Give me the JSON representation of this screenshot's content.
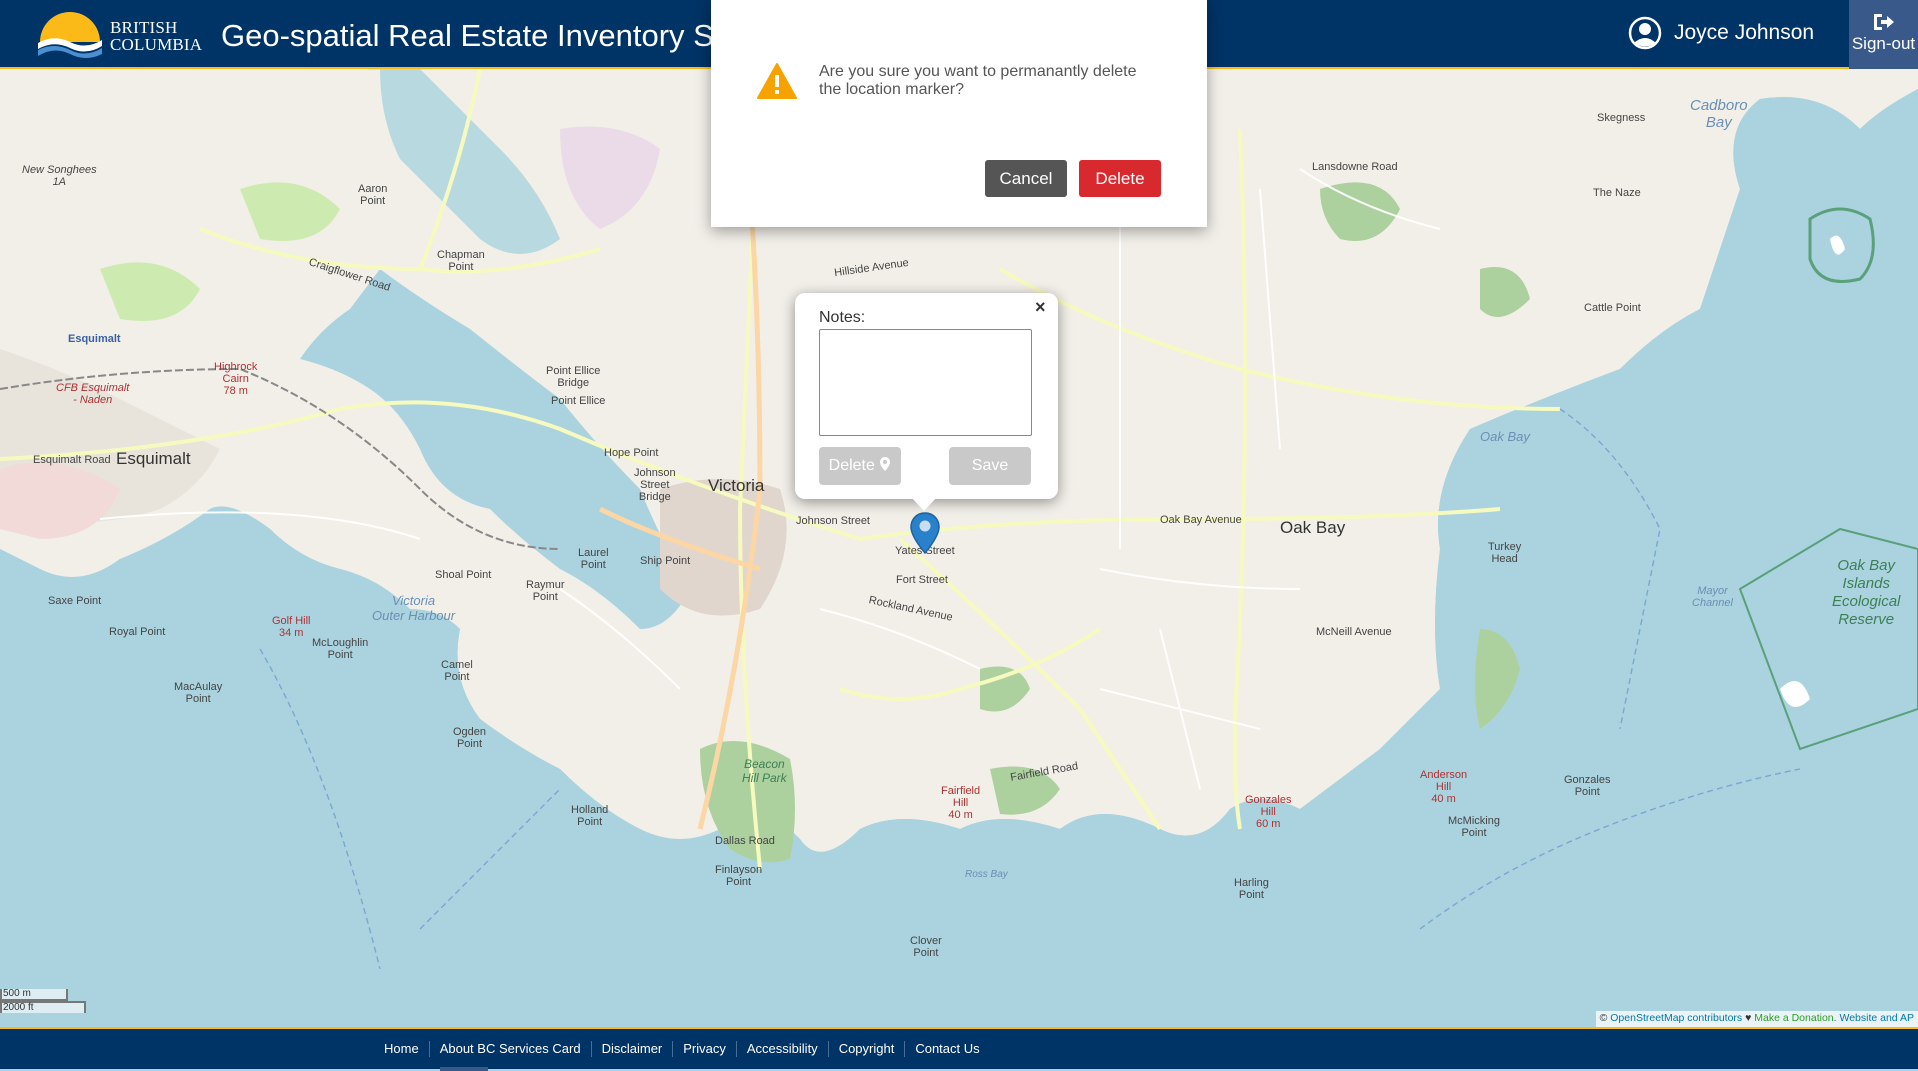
{
  "header": {
    "logo_line1": "British",
    "logo_line2": "Columbia",
    "title": "Geo-spatial Real Estate Inventory Sy",
    "user_name": "Joyce Johnson",
    "signout_label": "Sign-out"
  },
  "dialog": {
    "message": "Are you sure you want to permanantly delete the location marker?",
    "cancel_label": "Cancel",
    "delete_label": "Delete"
  },
  "popup": {
    "close_glyph": "×",
    "notes_label": "Notes:",
    "notes_value": "",
    "delete_label": "Delete",
    "save_label": "Save"
  },
  "map": {
    "labels": {
      "victoria": "Victoria",
      "esquimalt": "Esquimalt",
      "oak_bay": "Oak Bay",
      "esquimalt_small": "Esquimalt",
      "new_songhees": "New Songhees\n1A",
      "cfb": "CFB Esquimalt\n- Naden",
      "highrock": "Highrock\nCairn\n78 m",
      "golf_hill": "Golf Hill\n34 m",
      "beacon_hill": "Beacon\nHill Park",
      "fairfield_hill": "Fairfield\nHill\n40 m",
      "gonzales_hill": "Gonzales\nHill\n60 m",
      "anderson_hill": "Anderson\nHill\n40 m",
      "oak_bay_islands": "Oak Bay\nIslands\nEcological\nReserve",
      "cadboro_bay": "Cadboro\nBay",
      "oak_bay_water": "Oak Bay",
      "victoria_harbour": "Victoria\nOuter Harbour",
      "ross_bay": "Ross Bay",
      "mayor_channel": "Mayor\nChannel",
      "saxe_point": "Saxe Point",
      "royal_point": "Royal Point",
      "macaulay_point": "MacAulay\nPoint",
      "mcloughlin_point": "McLoughlin\nPoint",
      "shoal_point": "Shoal Point",
      "camel_point": "Camel\nPoint",
      "ogden_point": "Ogden\nPoint",
      "holland_point": "Holland\nPoint",
      "finlayson_point": "Finlayson\nPoint",
      "clover_point": "Clover\nPoint",
      "harling_point": "Harling\nPoint",
      "gonzales_point": "Gonzales\nPoint",
      "mcmicking_point": "McMicking\nPoint",
      "turkey_head": "Turkey\nHead",
      "cattle_point": "Cattle Point",
      "the_naze": "The Naze",
      "skegness": "Skegness",
      "point_ellice": "Point Ellice",
      "hope_point": "Hope Point",
      "johnson_bridge": "Johnson\nStreet\nBridge",
      "laurel_point": "Laurel\nPoint",
      "ship_point": "Ship Point",
      "raymur_point": "Raymur\nPoint",
      "chapman_point": "Chapman\nPoint",
      "aaron_point": "Aaron\nPoint",
      "point_ellice_bridge": "Point Ellice\nBridge",
      "mcneill_avenue": "McNeill Avenue",
      "oak_bay_avenue": "Oak Bay Avenue",
      "fort_street": "Fort Street",
      "yates_street": "Yates Street",
      "johnson_street": "Johnson Street",
      "rockland_avenue": "Rockland Avenue",
      "fairfield_road": "Fairfield Road",
      "dallas_road": "Dallas Road",
      "lansdowne_road": "Lansdowne Road",
      "hillside_avenue": "Hillside Avenue",
      "esquimalt_road": "Esquimalt Road",
      "craigflower_road": "Craigflower Road"
    },
    "scale_top": "500 m",
    "scale_bottom": "2000 ft",
    "attribution_prefix": "© ",
    "attribution_link": "OpenStreetMap contributors",
    "attribution_heart": " ♥ ",
    "attribution_donate": "Make a Donation",
    "attribution_rest": ". Website and AP"
  },
  "footer": {
    "links": [
      "Home",
      "About BC Services Card",
      "Disclaimer",
      "Privacy",
      "Accessibility",
      "Copyright",
      "Contact Us"
    ]
  },
  "colors": {
    "header_bg": "#003366",
    "accent_gold": "#fcba19",
    "delete_red": "#d8292f",
    "cancel_gray": "#555555",
    "marker_blue": "#2a81cb"
  }
}
